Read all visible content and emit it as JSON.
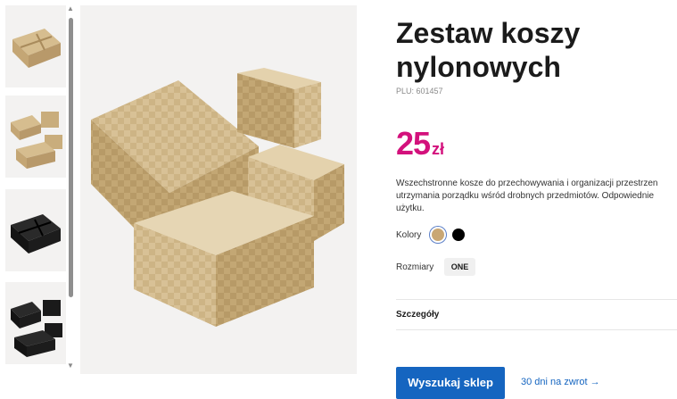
{
  "product": {
    "title": "Zestaw koszy nylonowych",
    "plu": "PLU: 601457",
    "price_amount": "25",
    "price_currency": "zł",
    "description_line1": "Wszechstronne kosze do przechowywania i organizacji przestrzen",
    "description_line2": "utrzymania porządku wśród drobnych przedmiotów. Odpowiednie",
    "description_line3": "użytku."
  },
  "colors": {
    "label": "Kolory",
    "options": [
      {
        "name": "gold",
        "hex": "#c9a774",
        "selected": true
      },
      {
        "name": "black",
        "hex": "#000000",
        "selected": false
      }
    ]
  },
  "sizes": {
    "label": "Rozmiary",
    "options": [
      "ONE"
    ]
  },
  "details": {
    "label": "Szczegóły"
  },
  "actions": {
    "find_store": "Wyszukaj sklep",
    "returns": "30 dni na zwrot →"
  },
  "gallery": {
    "thumbnails": [
      "gold-basket-set-top",
      "gold-basket-set-stacked",
      "black-basket-set-top",
      "black-basket-set-stacked"
    ],
    "scroll_up": "▲",
    "scroll_down": "▼"
  },
  "theme": {
    "price_color": "#d3117c",
    "accent_blue": "#1565c0",
    "gold": "#c9a774"
  }
}
